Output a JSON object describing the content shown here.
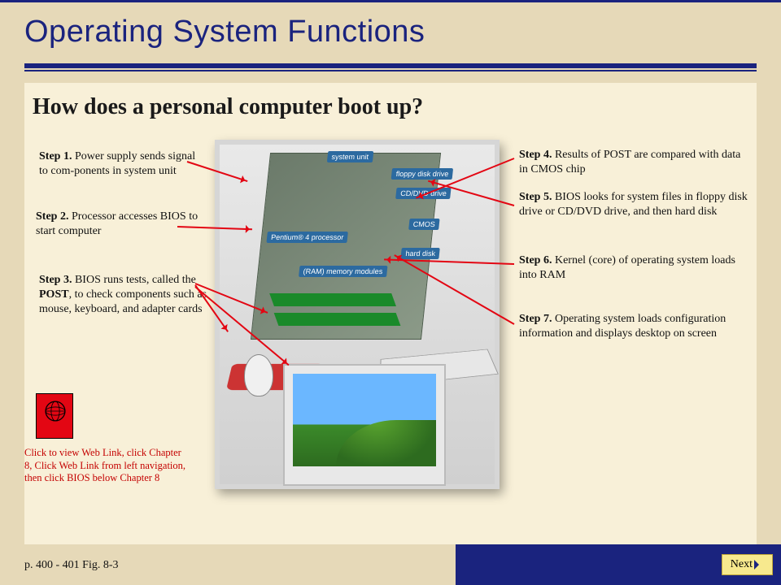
{
  "title": "Operating System Functions",
  "question": "How does a personal computer boot up?",
  "steps": {
    "s1": {
      "label": "Step 1.",
      "text": " Power supply sends signal to com-ponents in system unit"
    },
    "s2": {
      "label": "Step 2.",
      "text": " Processor accesses BIOS to start computer"
    },
    "s3": {
      "label": "Step 3.",
      "text_a": " BIOS runs tests, called the ",
      "bold": "POST",
      "text_b": ", to check components such as mouse, keyboard, and adapter cards"
    },
    "s4": {
      "label": "Step 4.",
      "text": "  Results of POST are compared with data in CMOS chip"
    },
    "s5": {
      "label": "Step 5.",
      "text": " BIOS looks for system files in floppy disk drive or CD/DVD drive, and then hard disk"
    },
    "s6": {
      "label": "Step 6.",
      "text": " Kernel (core) of operating system loads into RAM"
    },
    "s7": {
      "label": "Step 7.",
      "text": " Operating system loads configuration information and displays desktop on screen"
    }
  },
  "diagram_labels": {
    "system_unit": "system unit",
    "floppy": "floppy disk drive",
    "cddvd": "CD/DVD drive",
    "cmos": "CMOS",
    "processor": "Pentium® 4 processor",
    "hard": "hard disk",
    "ram": "(RAM) memory modules"
  },
  "weblink": "Click to view Web Link, click Chapter 8, Click Web Link from left navigation, then click BIOS below Chapter 8",
  "page_ref": "p. 400 - 401 Fig. 8-3",
  "next_label": "Next"
}
